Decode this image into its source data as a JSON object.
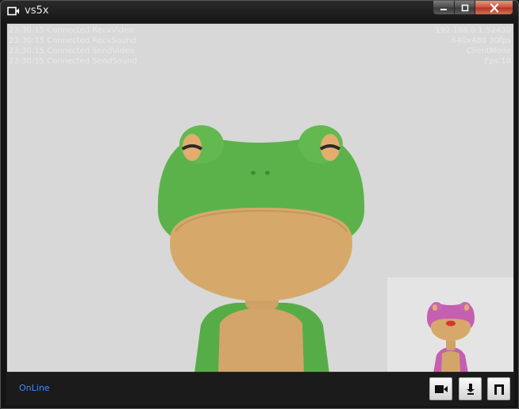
{
  "window": {
    "title": "vs5x",
    "caption_buttons": [
      "minimize",
      "maximize",
      "close"
    ]
  },
  "overlay": {
    "log_lines": [
      "23:30:15 Connected RecvVideo",
      "23:30:15 Connected RecvSound",
      "23:30:15 Connected SendVideo",
      "23:30:15 Connected SendSound"
    ],
    "stats_lines": [
      "192.168.0.1:52430",
      "640x480 30fps",
      "ClientMode",
      "Fps:10"
    ]
  },
  "statusbar": {
    "status": "OnLine",
    "status_color": "#3d8cff"
  },
  "controls": {
    "icons": [
      "video-camera-icon",
      "download-icon",
      "window-icon"
    ]
  },
  "colors": {
    "frog_green": "#5cb24a",
    "frog_skin": "#d6a96b",
    "frog_pink": "#c55fb0",
    "background": "#d8d8d8"
  }
}
